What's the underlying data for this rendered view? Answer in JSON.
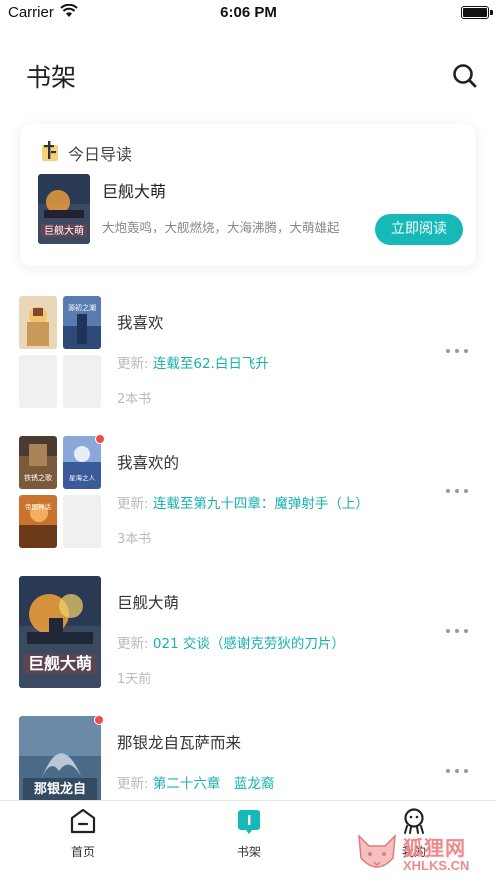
{
  "status_bar": {
    "carrier": "Carrier",
    "time": "6:06 PM"
  },
  "header": {
    "title": "书架",
    "search_icon": "search-icon"
  },
  "today": {
    "label": "今日导读",
    "book_title": "巨舰大萌",
    "description": "大炮轰鸣，大舰燃烧，大海沸腾，大萌雄起",
    "read_button": "立即阅读",
    "cover_text": "巨舰大萌"
  },
  "shelf": {
    "items": [
      {
        "title": "我喜欢",
        "update_label": "更新:",
        "update_value": "连载至62.白日飞升",
        "count": "2本书",
        "cover_texts": [
          "",
          "源初之潮"
        ]
      },
      {
        "title": "我喜欢的",
        "update_label": "更新:",
        "update_value": "连载至第九十四章：魔弹射手（上）",
        "count": "3本书",
        "cover_texts": [
          "铁锈之歌",
          "星海之人",
          "帝国神话"
        ]
      },
      {
        "title": "巨舰大萌",
        "update_label": "更新:",
        "update_value": "021 交谈（感谢克劳狄的刀片）",
        "count": "1天前",
        "cover_texts": [
          "巨舰大萌"
        ]
      },
      {
        "title": "那银龙自瓦萨而来",
        "update_label": "更新:",
        "update_value": "第二十六章　蓝龙裔",
        "count": "",
        "cover_texts": [
          "那银龙自"
        ]
      }
    ]
  },
  "tabbar": {
    "tabs": [
      {
        "label": "首页",
        "icon": "home-icon"
      },
      {
        "label": "书架",
        "icon": "bookshelf-icon"
      },
      {
        "label": "我的",
        "icon": "profile-icon"
      }
    ]
  },
  "watermark": {
    "name": "狐狸网",
    "url": "XHLKS.CN"
  },
  "colors": {
    "accent": "#17b8b8",
    "badge": "#f04a4a"
  }
}
